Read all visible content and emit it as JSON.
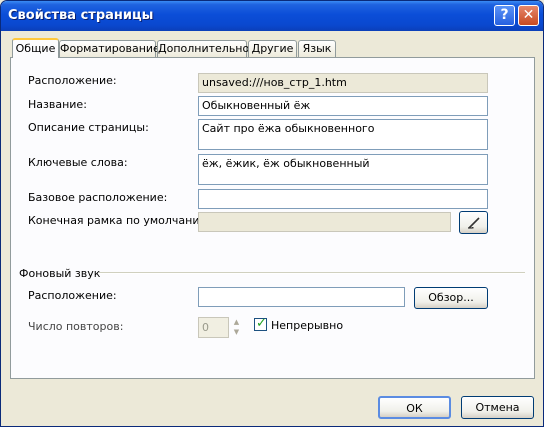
{
  "window": {
    "title": "Свойства страницы",
    "help_label": "?",
    "close_label": "✕"
  },
  "tabs": [
    {
      "label": "Общие",
      "active": true
    },
    {
      "label": "Форматирование"
    },
    {
      "label": "Дополнительно"
    },
    {
      "label": "Другие"
    },
    {
      "label": "Язык"
    }
  ],
  "general": {
    "location_label": "Расположение:",
    "location_value": "unsaved:///нов_стр_1.htm",
    "title_label": "Название:",
    "title_value": "Обыкновенный ёж",
    "description_label": "Описание страницы:",
    "description_value": "Сайт про ёжа обыкновенного",
    "keywords_label": "Ключевые слова:",
    "keywords_value": "ёж, ёжик, ёж обыкновенный",
    "base_location_label": "Базовое расположение:",
    "base_location_value": "",
    "default_frame_label": "Конечная рамка по умолчанию:",
    "default_frame_value": ""
  },
  "background_sound": {
    "section_label": "Фоновый звук",
    "location_label": "Расположение:",
    "location_value": "",
    "browse_label": "Обзор...",
    "repeat_label": "Число повторов:",
    "repeat_value": "0",
    "continuous_label": "Непрерывно",
    "continuous_checked": true
  },
  "footer": {
    "ok_label": "ОК",
    "cancel_label": "Отмена"
  },
  "icons": {
    "frame_picker": "pencil-icon",
    "spinner_up": "arrow-up-icon",
    "spinner_down": "arrow-down-icon",
    "checkmark": "checkmark-icon"
  }
}
